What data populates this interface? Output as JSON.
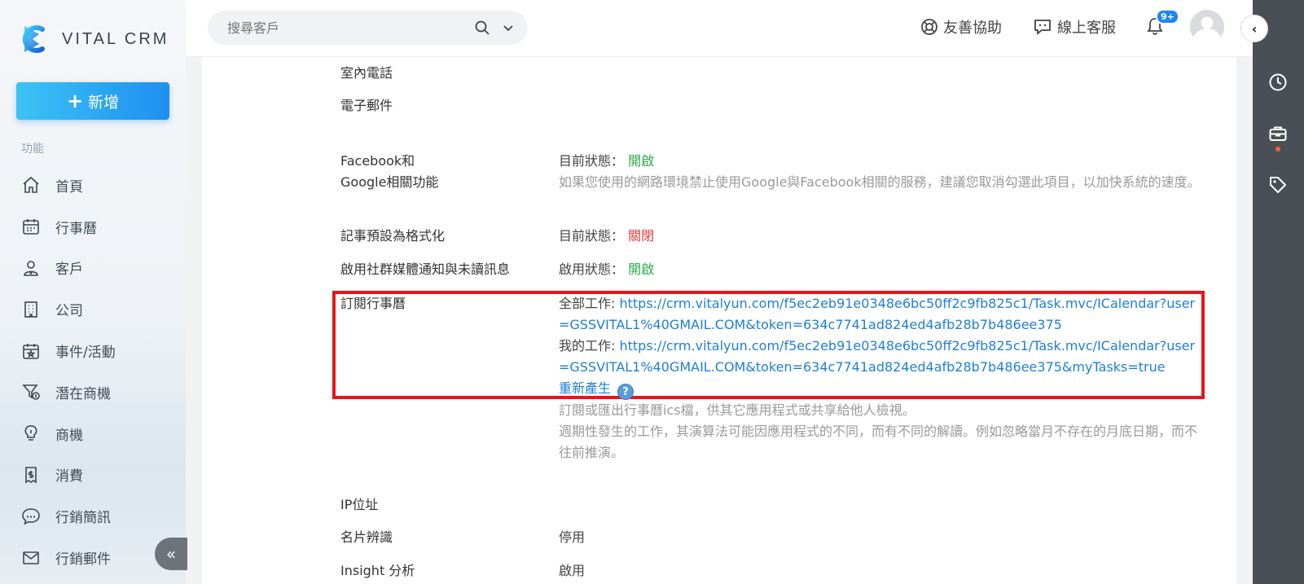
{
  "brand": {
    "name": "VITAL CRM"
  },
  "sidebar": {
    "add_label": "新增",
    "section_label": "功能",
    "items": [
      {
        "label": "首頁",
        "icon": "home-icon"
      },
      {
        "label": "行事曆",
        "icon": "calendar-icon"
      },
      {
        "label": "客戶",
        "icon": "customer-icon"
      },
      {
        "label": "公司",
        "icon": "building-icon"
      },
      {
        "label": "事件/活動",
        "icon": "event-icon"
      },
      {
        "label": "潛在商機",
        "icon": "funnel-icon"
      },
      {
        "label": "商機",
        "icon": "lightbulb-icon"
      },
      {
        "label": "消費",
        "icon": "receipt-icon"
      },
      {
        "label": "行銷簡訊",
        "icon": "sms-icon"
      },
      {
        "label": "行銷郵件",
        "icon": "mail-icon"
      }
    ]
  },
  "topbar": {
    "search_placeholder": "搜尋客戶",
    "help_label": "友善協助",
    "support_label": "線上客服",
    "notification_badge": "9+"
  },
  "settings": {
    "phone_label": "室內電話",
    "email_label": "電子郵件",
    "fbgoogle": {
      "label_line1": "Facebook和",
      "label_line2": "Google相關功能",
      "status_prefix": "目前狀態：",
      "status": "開啟",
      "note": "如果您使用的網路環境禁止使用Google與Facebook相關的服務，建議您取消勾選此項目，以加快系統的速度。"
    },
    "note_format": {
      "label": "記事預設為格式化",
      "status_prefix": "目前狀態：",
      "status": "關閉"
    },
    "social": {
      "label": "啟用社群媒體通知與未讀訊息",
      "status_prefix": "啟用狀態：",
      "status": "開啟"
    },
    "calendar_sub": {
      "label": "訂閱行事曆",
      "all_prefix": "全部工作: ",
      "all_url": "https://crm.vitalyun.com/f5ec2eb91e0348e6bc50ff2c9fb825c1/Task.mvc/ICalendar?user=GSSVITAL1%40GMAIL.COM&token=634c7741ad824ed4afb28b7b486ee375",
      "mine_prefix": "我的工作: ",
      "mine_url": "https://crm.vitalyun.com/f5ec2eb91e0348e6bc50ff2c9fb825c1/Task.mvc/ICalendar?user=GSSVITAL1%40GMAIL.COM&token=634c7741ad824ed4afb28b7b486ee375&myTasks=true",
      "regenerate": "重新產生",
      "note1": "訂閱或匯出行事曆ics檔，供其它應用程式或共享給他人檢視。",
      "note2": "週期性發生的工作，其演算法可能因應用程式的不同，而有不同的解讀。例如忽略當月不存在的月底日期，而不往前推演。"
    },
    "ip": {
      "label": "IP位址"
    },
    "card_scan": {
      "label": "名片辨識",
      "value": "停用"
    },
    "insight": {
      "label": "Insight 分析",
      "value": "啟用"
    }
  }
}
